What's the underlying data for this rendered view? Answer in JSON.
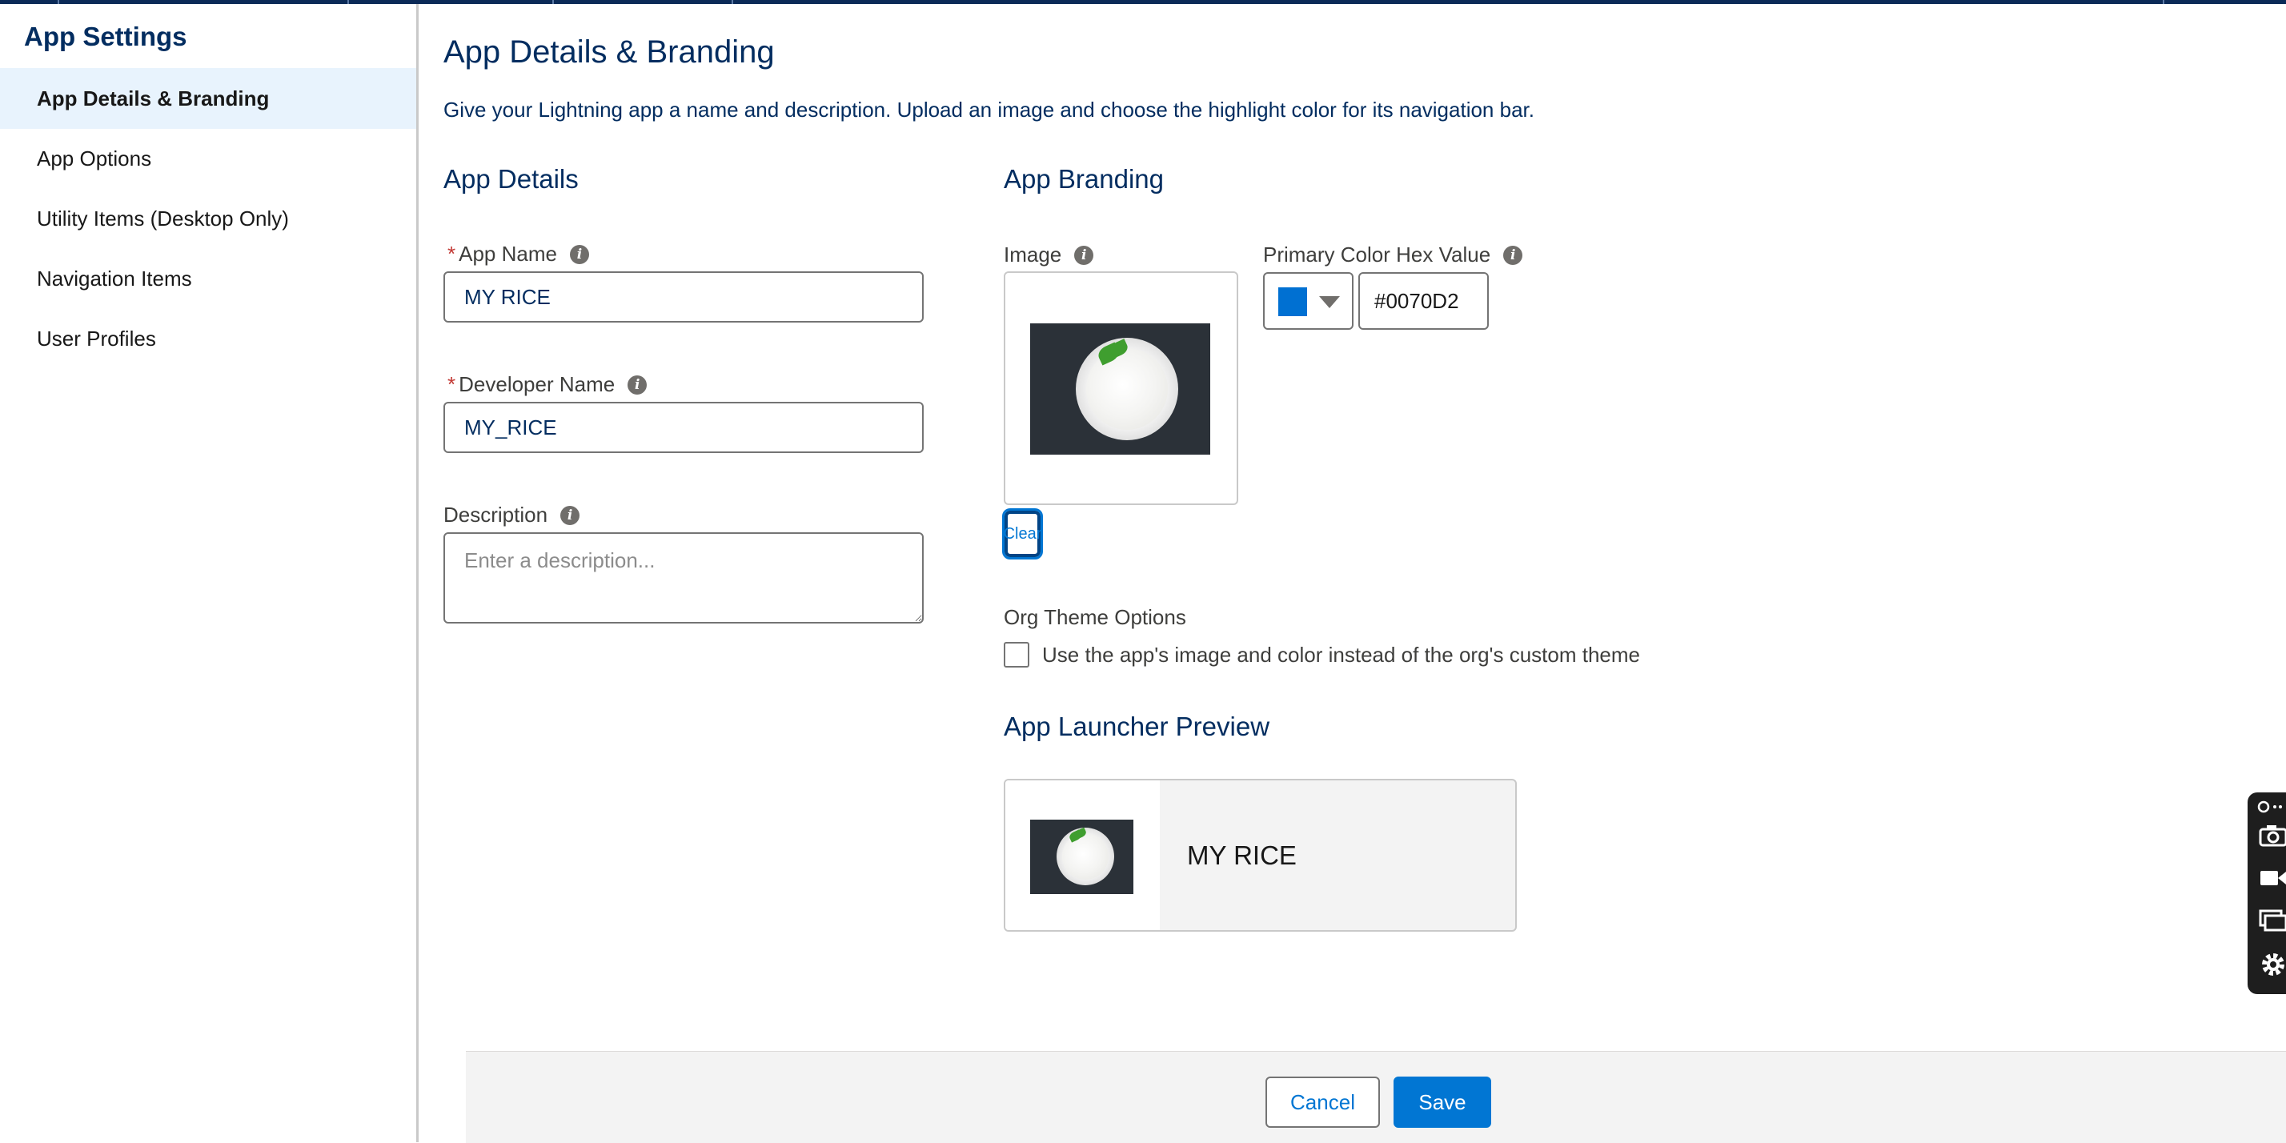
{
  "sidebar": {
    "title": "App Settings",
    "items": [
      {
        "label": "App Details & Branding",
        "active": true
      },
      {
        "label": "App Options"
      },
      {
        "label": "Utility Items (Desktop Only)"
      },
      {
        "label": "Navigation Items"
      },
      {
        "label": "User Profiles"
      }
    ]
  },
  "main": {
    "title": "App Details & Branding",
    "description": "Give your Lightning app a name and description. Upload an image and choose the highlight color for its navigation bar."
  },
  "app_details": {
    "heading": "App Details",
    "app_name": {
      "required_mark": "*",
      "label": "App Name",
      "value": "MY RICE"
    },
    "developer_name": {
      "required_mark": "*",
      "label": "Developer Name",
      "value": "MY_RICE"
    },
    "description": {
      "label": "Description",
      "placeholder": "Enter a description..."
    }
  },
  "app_branding": {
    "heading": "App Branding",
    "image_label": "Image",
    "clear_label": "Clear",
    "color_label": "Primary Color Hex Value",
    "color_value": "#0070D2",
    "swatch_color": "#0070D2"
  },
  "org_theme": {
    "label": "Org Theme Options",
    "checkbox_label": "Use the app's image and color instead of the org's custom theme",
    "checked": false
  },
  "launcher_preview": {
    "heading": "App Launcher Preview",
    "app_name": "MY RICE"
  },
  "footer": {
    "cancel_label": "Cancel",
    "save_label": "Save"
  },
  "icons": {
    "info": "info-icon",
    "dropdown": "chevron-down-icon",
    "floating_toolbar": [
      "pin-icon",
      "camera-icon",
      "video-icon",
      "window-icon",
      "gear-icon"
    ]
  },
  "colors": {
    "brand": "#0176d3",
    "heading": "#032d60",
    "active_nav": "#e8f3fd",
    "topbar": "#0b2a57"
  }
}
